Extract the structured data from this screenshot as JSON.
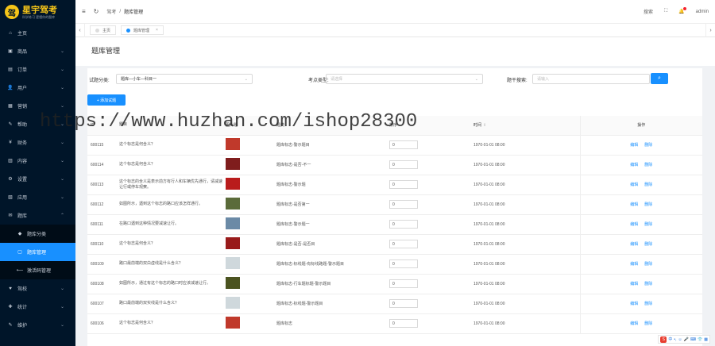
{
  "logo": {
    "name": "星宇驾考",
    "slogan": "科学练习 更懂你的题库"
  },
  "sidebar": {
    "items": [
      {
        "icon": "⌂",
        "label": "主页",
        "arrow": ""
      },
      {
        "icon": "▣",
        "label": "商品",
        "arrow": "⌄"
      },
      {
        "icon": "▤",
        "label": "订单",
        "arrow": "⌄"
      },
      {
        "icon": "👤",
        "label": "用户",
        "arrow": "⌄"
      },
      {
        "icon": "▦",
        "label": "营销",
        "arrow": "⌄"
      },
      {
        "icon": "✎",
        "label": "帮助",
        "arrow": "⌄"
      },
      {
        "icon": "¥",
        "label": "财务",
        "arrow": "⌄"
      },
      {
        "icon": "▥",
        "label": "内容",
        "arrow": "⌄"
      },
      {
        "icon": "⚙",
        "label": "设置",
        "arrow": "⌄"
      },
      {
        "icon": "▧",
        "label": "应用",
        "arrow": "⌄"
      },
      {
        "icon": "✉",
        "label": "题库",
        "arrow": "⌃"
      }
    ],
    "submenu": [
      {
        "icon": "◆",
        "label": "题库分类"
      },
      {
        "icon": "▢",
        "label": "题库管理"
      },
      {
        "icon": "⟵",
        "label": "激活码管理"
      }
    ],
    "bottom": [
      {
        "icon": "♥",
        "label": "驾校",
        "arrow": "⌄"
      },
      {
        "icon": "✚",
        "label": "统计",
        "arrow": "⌄"
      },
      {
        "icon": "✎",
        "label": "维护",
        "arrow": "⌄"
      }
    ]
  },
  "header": {
    "menu_icon": "≡",
    "refresh_icon": "↻",
    "crumb_home": "驾考",
    "crumb_sep": "/",
    "crumb_current": "题库管理",
    "search": "搜索",
    "fullscreen": "⛶",
    "user": "admin"
  },
  "tabs": {
    "home": "主页",
    "current": "题库管理"
  },
  "page_title": "题库管理",
  "filters": {
    "cat_label": "试题分类:",
    "cat_value": "题库—小车—科目一",
    "type_label": "考点类型:",
    "type_placeholder": "请选择",
    "kw_label": "题干搜索:",
    "kw_placeholder": "请输入"
  },
  "add_button": "+ 添加试题",
  "table": {
    "headers": {
      "id": "ID",
      "title": "题目",
      "img": "图片题",
      "type": "题类",
      "sort": "排序",
      "time": "时间",
      "op": "操作"
    },
    "rows": [
      {
        "id": "600115",
        "title": "这个标志是何含义？",
        "type": "题库标志-警示题目",
        "sort": "0",
        "time": "1970-01-01 08:00",
        "img": "#c0392b",
        "edit": "编辑",
        "del": "删除"
      },
      {
        "id": "600114",
        "title": "这个标志是何含义？",
        "type": "题库标志-是否-不一",
        "sort": "0",
        "time": "1970-01-01 08:00",
        "img": "#7f1d1d",
        "edit": "编辑",
        "del": "删除"
      },
      {
        "id": "600113",
        "title": "这个标志的含义是表示前方有行人和车辆优先通行，请减速让行或停车观察。",
        "type": "题库标志-警示题",
        "sort": "0",
        "time": "1970-01-01 08:00",
        "img": "#b91c1c",
        "edit": "编辑",
        "del": "删除"
      },
      {
        "id": "600112",
        "title": "如图所示，遇到这个标志的路口应该怎样通行。",
        "type": "题库标志-是否第一",
        "sort": "0",
        "time": "1970-01-01 08:00",
        "img": "#5b6b3a",
        "edit": "编辑",
        "del": "删除"
      },
      {
        "id": "600111",
        "title": "在路口遇到这种情况要减速让行。",
        "type": "题库标志-警示题一",
        "sort": "0",
        "time": "1970-01-01 08:00",
        "img": "#6b8aa6",
        "edit": "编辑",
        "del": "删除"
      },
      {
        "id": "600110",
        "title": "这个标志是何含义？",
        "type": "题库标志-是否-是否目",
        "sort": "0",
        "time": "1970-01-01 08:00",
        "img": "#991b1b",
        "edit": "编辑",
        "del": "删除"
      },
      {
        "id": "600109",
        "title": "路口最前端的双白虚线是什么含义？",
        "type": "题库标志-标线题-有标线路题-警示题目",
        "sort": "0",
        "time": "1970-01-01 08:00",
        "img": "#cfd8dc",
        "edit": "编辑",
        "del": "删除"
      },
      {
        "id": "600108",
        "title": "如图所示，通过有这个标志的路口时应该减速让行。",
        "type": "题库标志-行车题标题-警示题目",
        "sort": "0",
        "time": "1970-01-01 08:00",
        "img": "#4b5320",
        "edit": "编辑",
        "del": "删除"
      },
      {
        "id": "600107",
        "title": "路口最前端的双实线是什么含义？",
        "type": "题库标志-标线题-警示题目",
        "sort": "0",
        "time": "1970-01-01 08:00",
        "img": "#cfd8dc",
        "edit": "编辑",
        "del": "删除"
      },
      {
        "id": "600106",
        "title": "这个标志是何含义？",
        "type": "题库标志",
        "sort": "0",
        "time": "1970-01-01 08:00",
        "img": "#c0392b",
        "edit": "编辑",
        "del": "删除"
      }
    ]
  },
  "watermark": "https://www.huzhan.com/ishop28300",
  "ime": {
    "s": "S",
    "zh": "中",
    "items": [
      "•,",
      "☺",
      "🎤",
      "⌨",
      "👕",
      "▦"
    ]
  }
}
